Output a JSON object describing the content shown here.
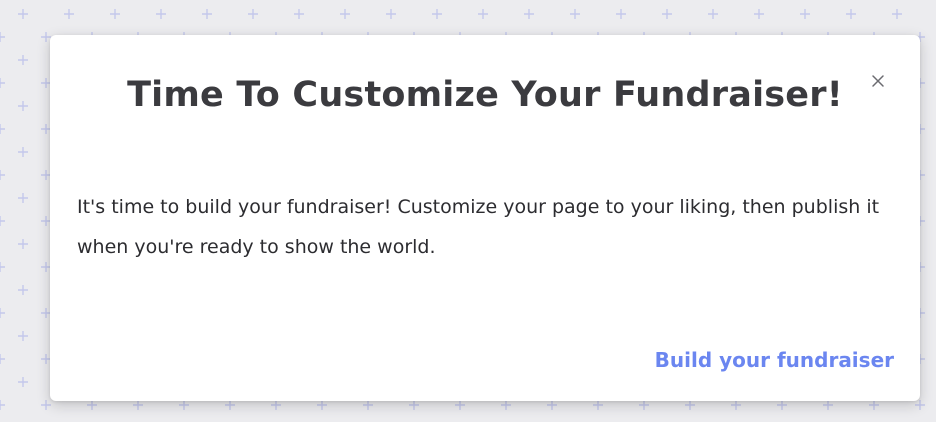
{
  "theme": {
    "accent": "#6b86f0",
    "background": "#ececef",
    "pattern_color": "#c4c8ec",
    "modal_background": "#ffffff",
    "title_color": "#3b3b3f",
    "body_color": "#2c2c30"
  },
  "modal": {
    "title": "Time To Customize Your Fundraiser!",
    "close_icon": "close-icon",
    "body": "It's time to build your fundraiser! Customize your page to your liking, then publish it when you're ready to show the world.",
    "action_label": "Build your fundraiser"
  }
}
